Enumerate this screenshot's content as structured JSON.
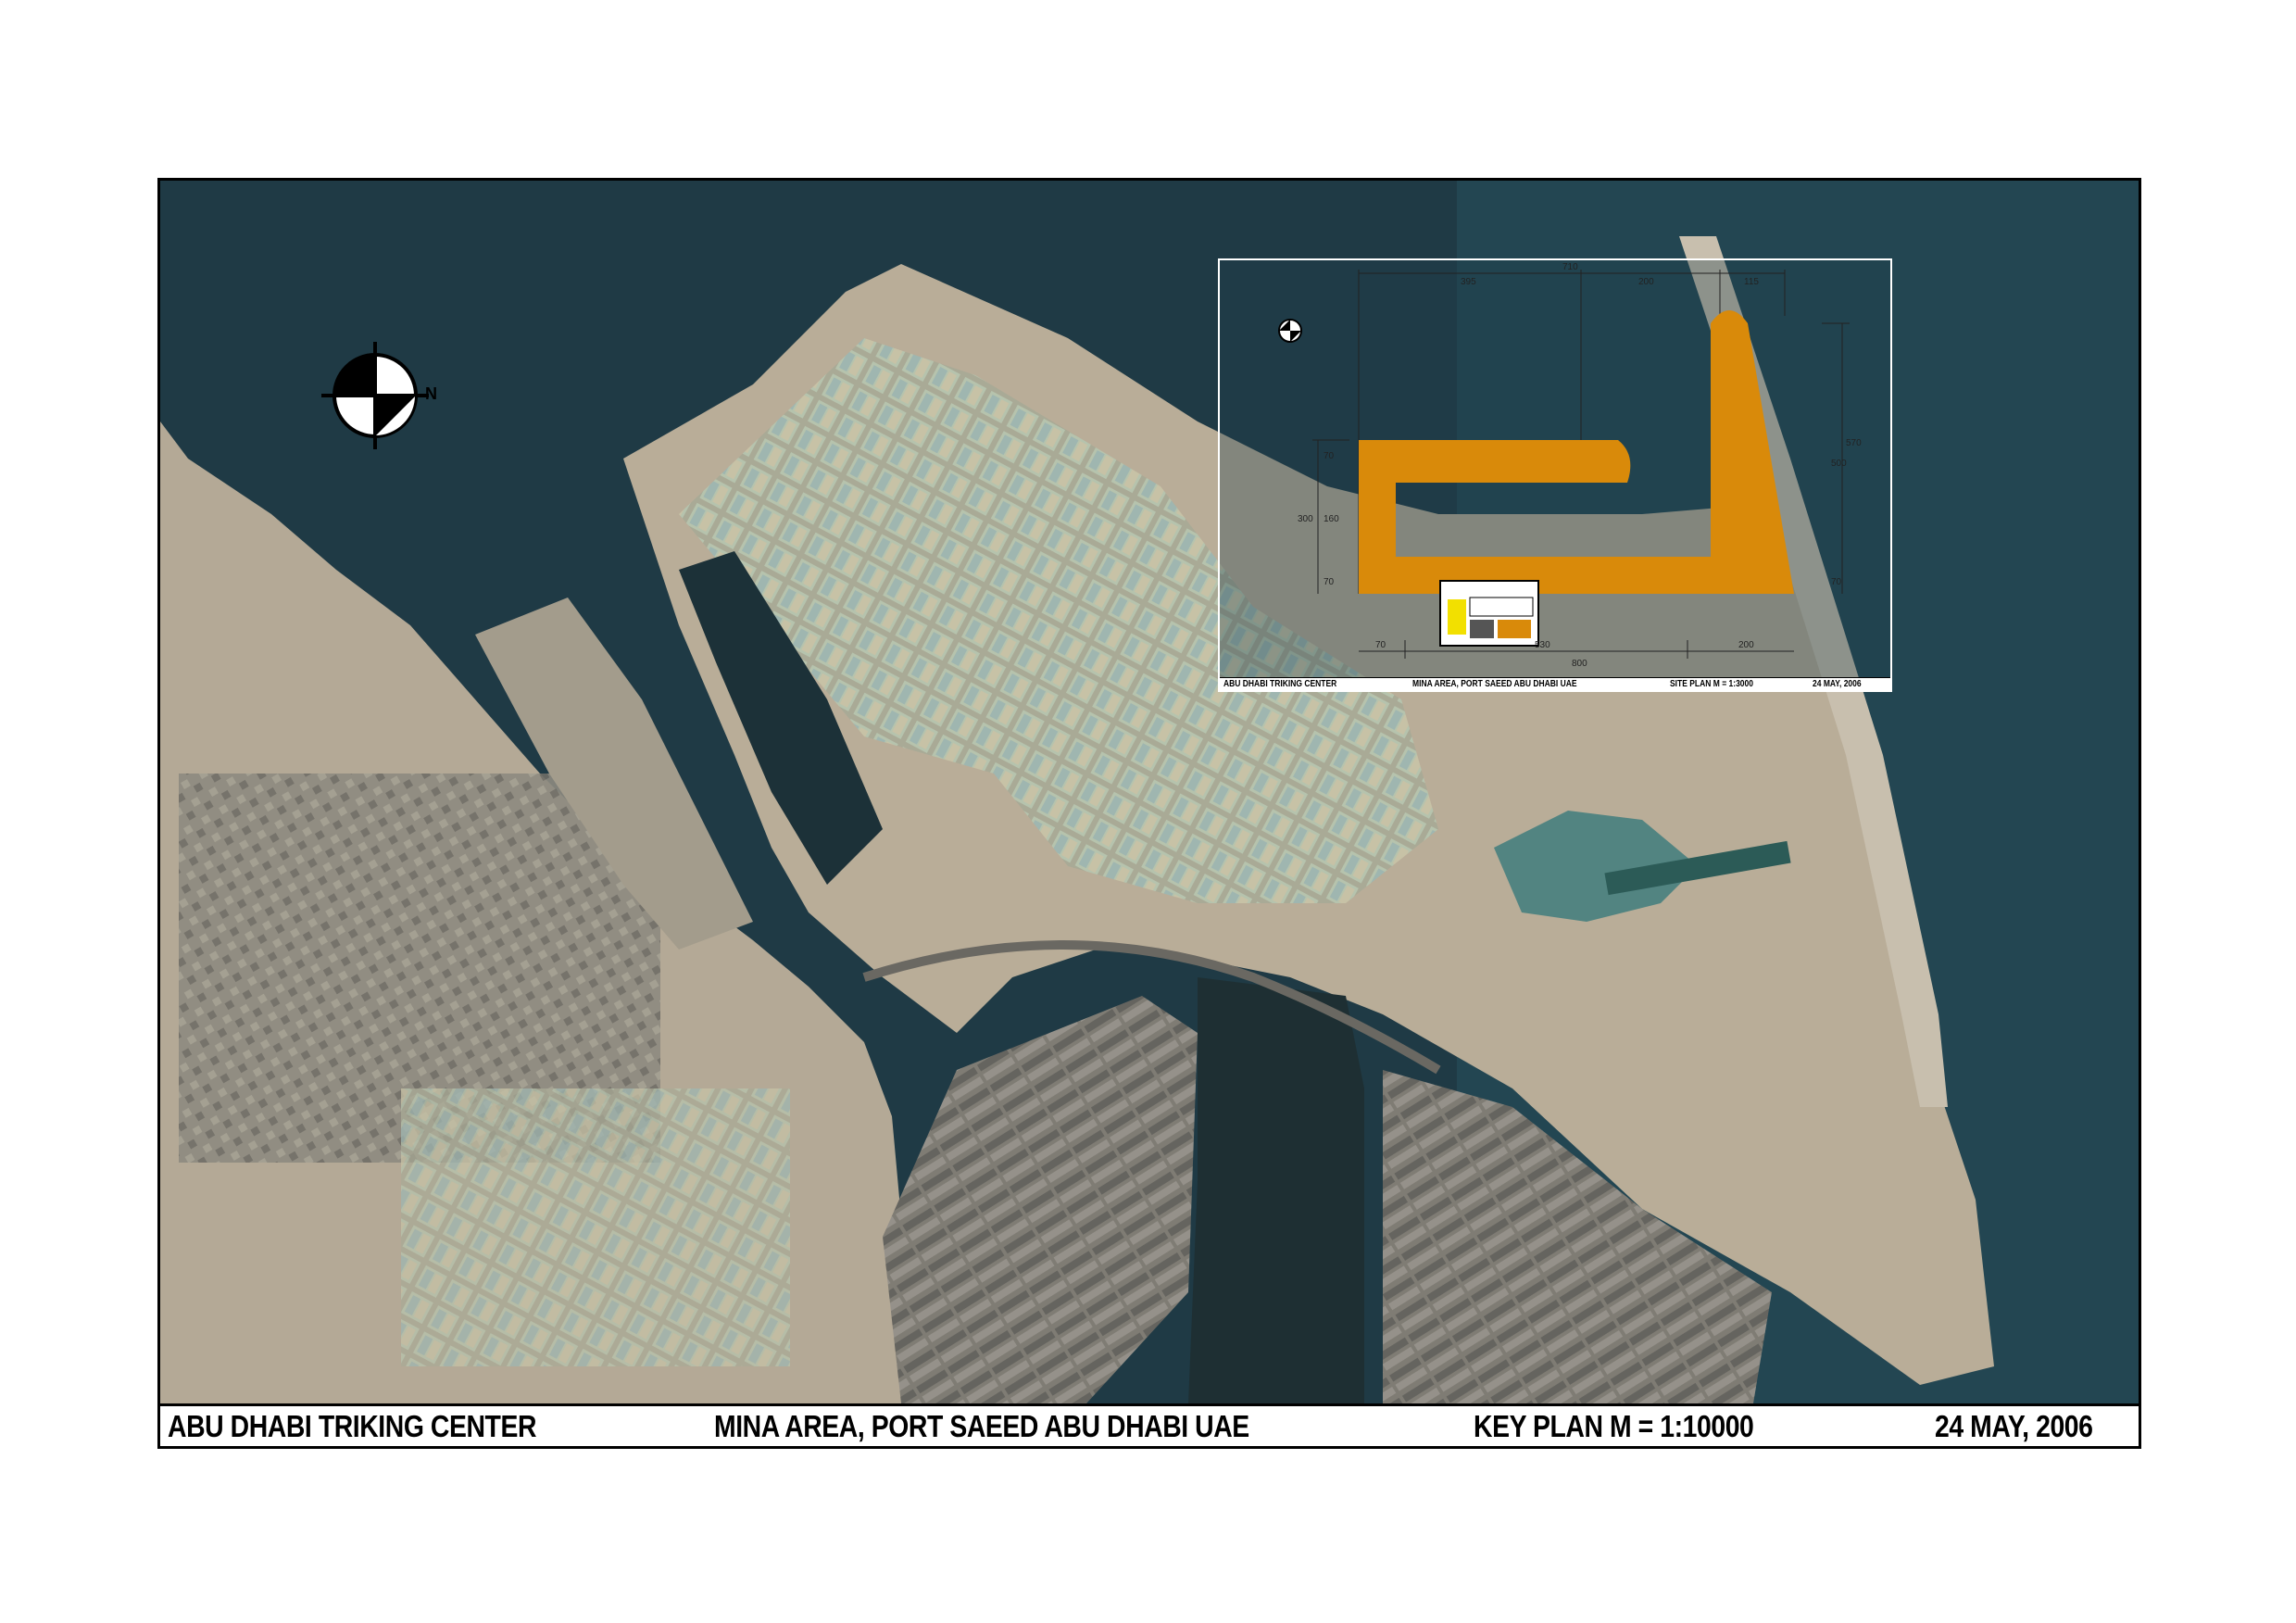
{
  "key_plan": {
    "project": "ABU DHABI TRIKING CENTER",
    "location": "MINA AREA, PORT SAEED ABU DHABI UAE",
    "plan": "KEY PLAN   M = 1:10000",
    "date": "24 MAY, 2006"
  },
  "site_plan": {
    "project": "ABU DHABI TRIKING CENTER",
    "location": "MINA AREA, PORT SAEED ABU DHABI UAE",
    "plan": "SITE PLAN  M = 1:3000",
    "date": "24 MAY, 2006"
  },
  "north_label": "N",
  "dimensions": {
    "top_total": "710",
    "top_a": "395",
    "top_b": "200",
    "top_c": "115",
    "bottom_a": "70",
    "bottom_b": "530",
    "bottom_c": "200",
    "bottom_total": "800",
    "left_a": "70",
    "left_b": "160",
    "left_c": "70",
    "left_total": "300",
    "right_a": "570",
    "right_b": "500",
    "right_c": "70"
  },
  "colors": {
    "sea": "#1f3a45",
    "land": "#b9ad98",
    "development": "#d98a0a"
  }
}
